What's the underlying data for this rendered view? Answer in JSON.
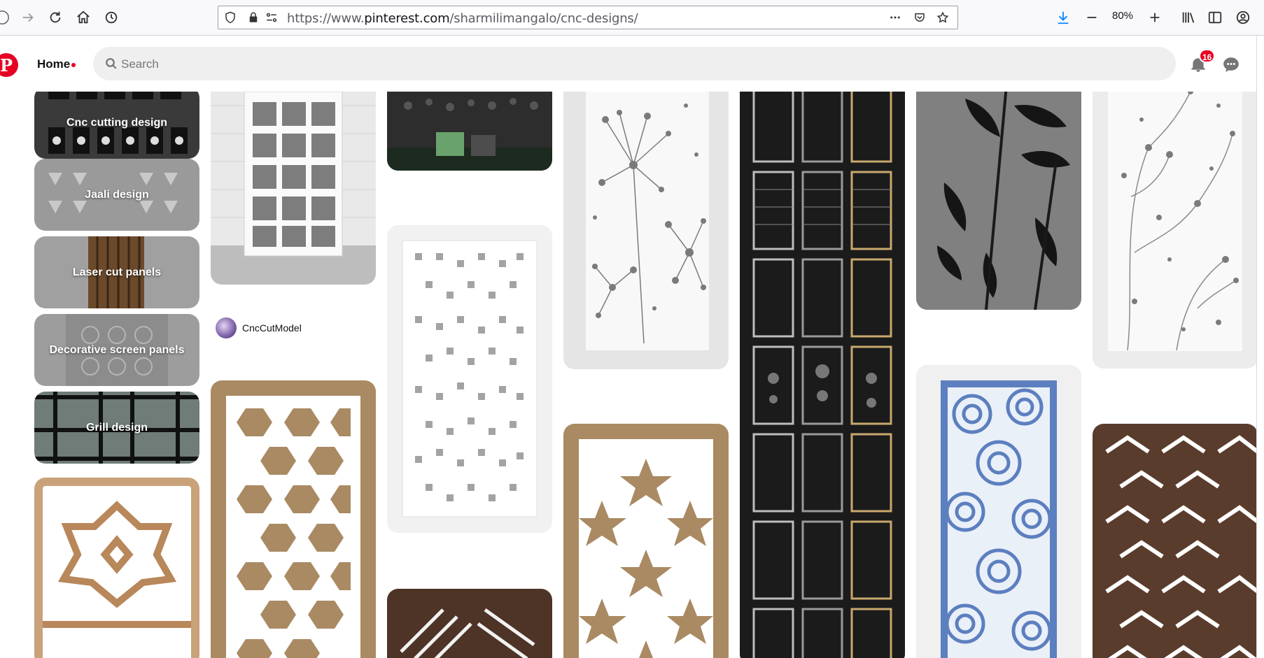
{
  "browser": {
    "url_prefix": "https://www.",
    "url_domain": "pinterest.com",
    "url_path": "/sharmilimangalo/cnc-designs/",
    "zoom": "80%"
  },
  "header": {
    "home_label": "Home",
    "search_placeholder": "Search",
    "notification_count": "16"
  },
  "boards": [
    {
      "label": "Cnc cutting design"
    },
    {
      "label": "Jaali design"
    },
    {
      "label": "Laser cut panels"
    },
    {
      "label": "Decorative screen panels"
    },
    {
      "label": "Grill design"
    }
  ],
  "pinner": {
    "name": "CncCutModel"
  },
  "colors": {
    "brand": "#e60023",
    "search_bg": "#efefef",
    "wood": "#a98a63",
    "rust": "#5a3c2c",
    "blue_panel": "#5c7fbf"
  }
}
